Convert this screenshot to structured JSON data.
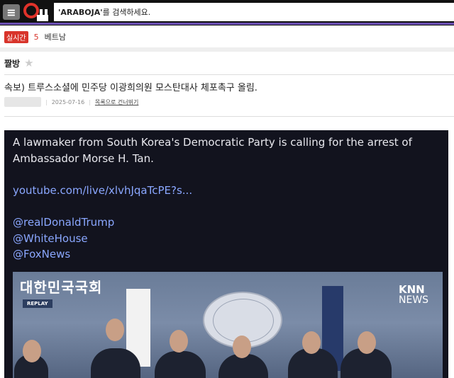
{
  "header": {
    "menu_icon": "≡",
    "search_keyword": "'ARABOJA'",
    "search_suffix": " 를 검색하세요."
  },
  "realtime": {
    "badge": "실시간",
    "rank": "5",
    "term": "베트남"
  },
  "board": {
    "name": "짤방",
    "star_icon": "★"
  },
  "post": {
    "title": "속보) 트루스소셜에 민주당 이광희의원 모스탄대사 체포촉구 올림.",
    "date": "2025-07-16",
    "list_link": "목록으로 건너뛰기",
    "content": {
      "line1": "A lawmaker from South Korea's Democratic Party is calling for the arrest of",
      "line2": "Ambassador Morse H. Tan.",
      "link": "youtube.com/live/xlvhJqaTcPE?s...",
      "mention1": "@realDonaldTrump",
      "mention2": "@WhiteHouse",
      "mention3": "@FoxNews"
    },
    "video": {
      "caption": "대한민국국회",
      "replay": "REPLAY",
      "channel_top": "KNN",
      "channel_bottom": "NEWS"
    }
  },
  "colors": {
    "accent": "#6b4fb3",
    "badge": "#d8342b",
    "logo": "#e0322a",
    "post_bg": "#12131e",
    "link": "#8aa7ff"
  }
}
